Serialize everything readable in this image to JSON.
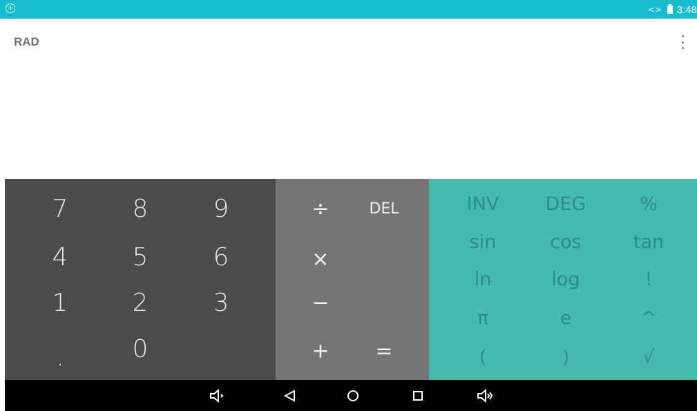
{
  "status_bar": {
    "time": "3:48",
    "left_icon": "android-notification-icon",
    "sync_icon": "sync-icon",
    "battery_icon": "battery-icon",
    "background": "#17bccf"
  },
  "display": {
    "angle_mode": "RAD",
    "menu_icon": "overflow-menu-icon"
  },
  "numeric_pad": {
    "keys": [
      "7",
      "8",
      "9",
      "4",
      "5",
      "6",
      "1",
      "2",
      "3",
      ".",
      "0"
    ],
    "background": "#4a4b4d"
  },
  "operator_pad": {
    "divide": "÷",
    "delete": "DEL",
    "multiply": "×",
    "subtract": "−",
    "add": "+",
    "equals": "=",
    "background": "#737577"
  },
  "advanced_pad": {
    "keys": [
      "INV",
      "DEG",
      "%",
      "sin",
      "cos",
      "tan",
      "ln",
      "log",
      "!",
      "π",
      "e",
      "^",
      "(",
      ")",
      "√"
    ],
    "background": "#45bbad",
    "text_color": "#2c8e83"
  },
  "navigation_bar": {
    "icons": [
      "volume-down-icon",
      "back-icon",
      "home-icon",
      "recent-apps-icon",
      "volume-up-icon"
    ]
  }
}
